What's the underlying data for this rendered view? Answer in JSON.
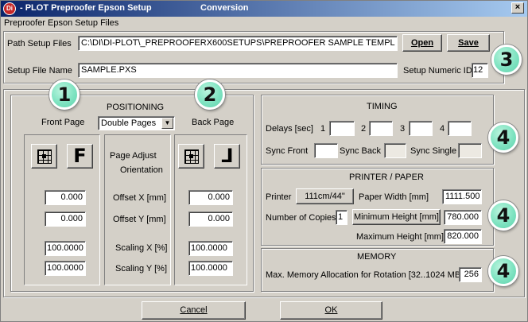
{
  "window": {
    "title": "- PLOT  Preproofer Epson Setup",
    "title_mode": "Conversion",
    "subtitle": "Preproofer Epson Setup Files",
    "close_glyph": "×",
    "app_icon_text": "Di"
  },
  "files": {
    "path_label": "Path Setup Files",
    "path_value": "C:\\DI\\DI-PLOT\\_PREPROOFERX600SETUPS\\PREPROOFER SAMPLE TEMPL",
    "name_label": "Setup File Name",
    "name_value": "SAMPLE.PXS",
    "numeric_id_label": "Setup Numeric ID",
    "numeric_id_value": "12",
    "open_label": "Open",
    "save_label": "Save"
  },
  "positioning": {
    "front_page_label": "Front Page",
    "back_page_label": "Back Page",
    "heading": "POSITIONING",
    "mode_value": "Double Pages",
    "page_adjust_label": "Page Adjust",
    "orientation_label": "Orientation",
    "front_orient_glyph": "F",
    "back_orient_glyph": "⅃",
    "offset_x_label": "Offset X [mm]",
    "offset_y_label": "Offset Y [mm]",
    "scaling_x_label": "Scaling X [%]",
    "scaling_y_label": "Scaling Y [%]",
    "front": {
      "offset_x": "0.000",
      "offset_y": "0.000",
      "scaling_x": "100.0000",
      "scaling_y": "100.0000"
    },
    "back": {
      "offset_x": "0.000",
      "offset_y": "0.000",
      "scaling_x": "100.0000",
      "scaling_y": "100.0000"
    }
  },
  "timing": {
    "heading": "TIMING",
    "delays_label": "Delays [sec]",
    "delay_labels": [
      "1",
      "2",
      "3",
      "4"
    ],
    "sync_front_label": "Sync Front",
    "sync_back_label": "Sync Back",
    "sync_single_label": "Sync Single"
  },
  "printer": {
    "heading": "PRINTER / PAPER",
    "printer_label": "Printer",
    "printer_value": "111cm/44\"",
    "paper_width_label": "Paper Width [mm]",
    "paper_width_value": "1111.500",
    "copies_label": "Number of Copies",
    "copies_value": "1",
    "min_height_label": "Minimum Height [mm]",
    "min_height_value": "780.000",
    "max_height_label": "Maximum Height [mm]",
    "max_height_value": "820.000"
  },
  "memory": {
    "heading": "MEMORY",
    "label": "Max. Memory Allocation for Rotation [32..1024 MB]",
    "value": "256"
  },
  "footer": {
    "cancel_label": "Cancel",
    "ok_label": "OK"
  },
  "callouts": [
    "1",
    "2",
    "3",
    "4",
    "4",
    "4"
  ]
}
